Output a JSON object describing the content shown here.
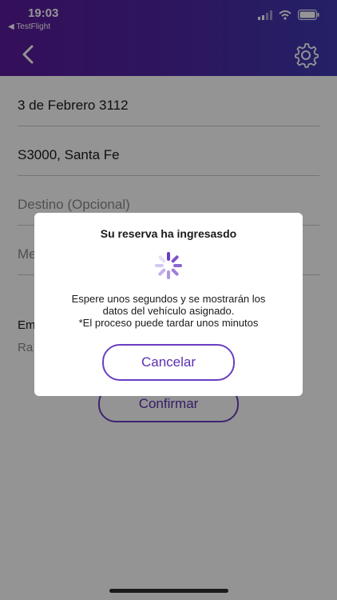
{
  "status_bar": {
    "time": "19:03",
    "back_app": "◀ TestFlight"
  },
  "header": {
    "back_icon": "chevron-left-icon",
    "settings_icon": "gear-icon"
  },
  "form": {
    "address": "3 de Febrero 3112",
    "city": "S3000, Santa Fe",
    "destination_placeholder": "Destino (Opcional)",
    "message_placeholder": "Me",
    "section_label_1": "Em",
    "section_label_2": "Ra",
    "confirm_label": "Confirmar"
  },
  "modal": {
    "title": "Su reserva ha ingresasdo",
    "message_lines": [
      "Espere unos segundos y se mostrarán los",
      "datos del vehículo asignado.",
      "*El proceso puede tardar unos minutos"
    ],
    "cancel_label": "Cancelar"
  },
  "colors": {
    "accent": "#6a3ec2",
    "header_start": "#5b1a9b",
    "header_end": "#3f3ab0"
  }
}
